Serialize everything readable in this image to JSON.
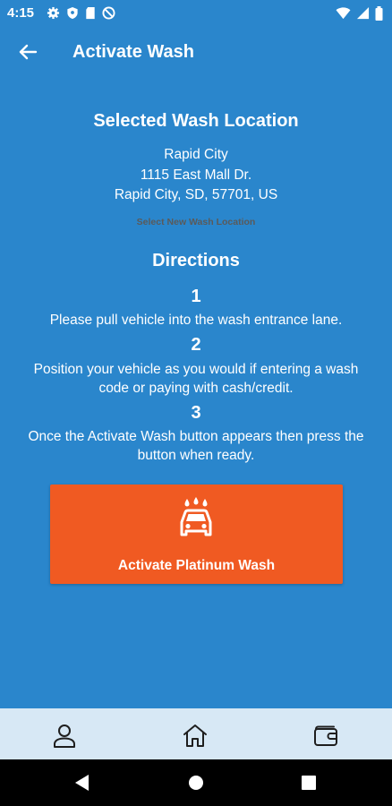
{
  "status": {
    "time": "4:15"
  },
  "header": {
    "title": "Activate Wash"
  },
  "location": {
    "title": "Selected Wash Location",
    "name": "Rapid City",
    "street": "1115 East Mall Dr.",
    "city_line": "Rapid City, SD, 57701, US",
    "change_link": "Select New Wash Location"
  },
  "directions": {
    "title": "Directions",
    "steps": [
      {
        "num": "1",
        "text": "Please pull vehicle into the wash entrance lane."
      },
      {
        "num": "2",
        "text": "Position your vehicle as you would if entering a wash code or paying with cash/credit."
      },
      {
        "num": "3",
        "text": "Once the Activate Wash button appears then press the button when ready."
      }
    ]
  },
  "action": {
    "label": "Activate Platinum Wash",
    "icon": "car-wash-icon",
    "color": "#f05a22"
  },
  "bottom_nav": {
    "items": [
      {
        "icon": "profile-icon"
      },
      {
        "icon": "home-icon"
      },
      {
        "icon": "wallet-icon"
      }
    ]
  },
  "colors": {
    "background": "#2a86cc",
    "nav_background": "#d7e8f5",
    "accent": "#f05a22"
  }
}
